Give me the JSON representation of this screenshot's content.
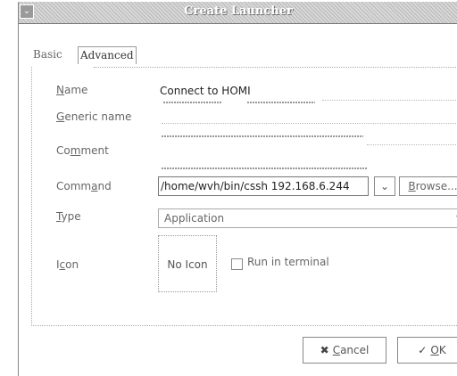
{
  "window": {
    "title": "Create Launcher",
    "menu_icon": "window-menu-icon"
  },
  "tabs": [
    {
      "label": "Basic",
      "active": false
    },
    {
      "label": "Advanced",
      "active": true
    }
  ],
  "fields": {
    "name": {
      "label_mnemonic": "N",
      "label_rest": "ame",
      "value": "Connect to HOMI"
    },
    "generic_name": {
      "label_mnemonic": "G",
      "label_rest": "eneric name",
      "value": ""
    },
    "comment": {
      "label_pre": "Co",
      "label_mnemonic": "m",
      "label_rest": "ment",
      "value": ""
    },
    "command": {
      "label_pre": "Comm",
      "label_mnemonic": "a",
      "label_rest": "nd",
      "value": "/home/wvh/bin/cssh 192.168.6.244"
    },
    "type": {
      "label_mnemonic": "T",
      "label_rest": "ype",
      "value": "Application"
    },
    "icon": {
      "label_pre": "I",
      "label_mnemonic": "c",
      "label_rest": "on",
      "button_text": "No Icon"
    }
  },
  "command_dropdown_icon": "chevron-down-icon",
  "browse_button": {
    "mnemonic": "B",
    "rest": "rowse..."
  },
  "run_in_terminal": {
    "label": "Run in terminal",
    "checked": false
  },
  "buttons": {
    "cancel": {
      "icon": "cancel-icon",
      "mnemonic": "C",
      "rest": "ancel"
    },
    "ok": {
      "icon": "ok-icon",
      "mnemonic": "O",
      "rest": "K"
    }
  },
  "colors": {
    "titlebar": "#c8c8c8",
    "border": "#888888",
    "text": "#555555"
  }
}
